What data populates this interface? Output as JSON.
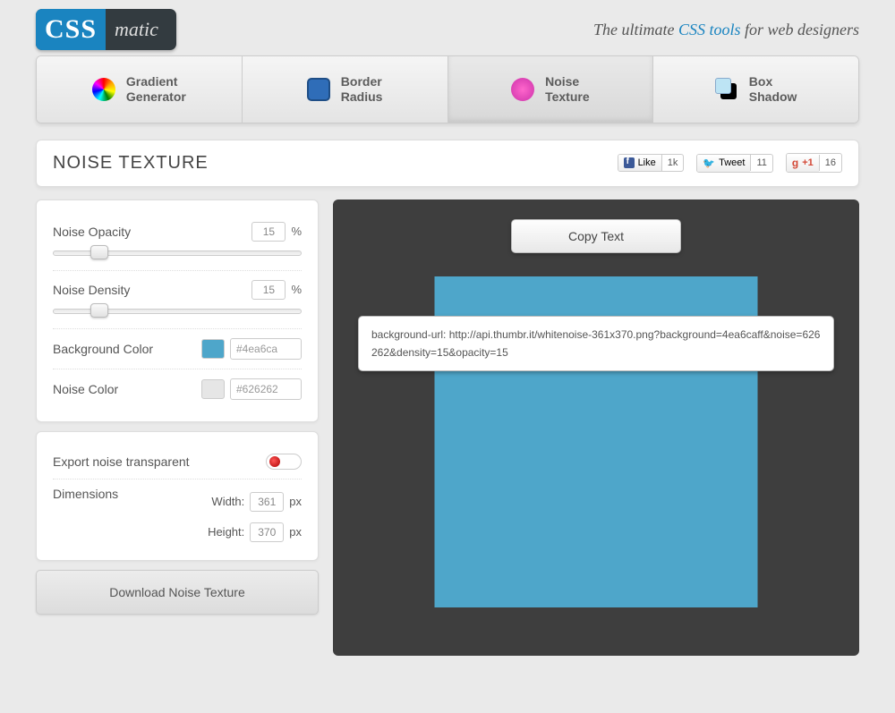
{
  "brand": {
    "left": "CSS",
    "right": "matic"
  },
  "tagline": {
    "pre": "The ultimate ",
    "accent": "CSS tools",
    "post": " for web designers"
  },
  "tabs": [
    {
      "label": "Gradient\nGenerator"
    },
    {
      "label": "Border\nRadius"
    },
    {
      "label": "Noise\nTexture"
    },
    {
      "label": "Box\nShadow"
    }
  ],
  "page_title": "NOISE TEXTURE",
  "social": {
    "fb": {
      "label": "Like",
      "count": "1k"
    },
    "tw": {
      "label": "Tweet",
      "count": "11"
    },
    "gp": {
      "label": "+1",
      "count": "16"
    }
  },
  "controls": {
    "opacity": {
      "label": "Noise Opacity",
      "value": "15",
      "unit": "%"
    },
    "density": {
      "label": "Noise Density",
      "value": "15",
      "unit": "%"
    },
    "bg": {
      "label": "Background Color",
      "hex": "#4ea6ca"
    },
    "noise": {
      "label": "Noise Color",
      "hex": "#626262"
    },
    "export": {
      "label": "Export noise transparent"
    },
    "dims": {
      "label": "Dimensions",
      "width_label": "Width:",
      "width": "361",
      "height_label": "Height:",
      "height": "370",
      "px": "px"
    }
  },
  "download_label": "Download Noise Texture",
  "preview": {
    "copy_label": "Copy Text",
    "code": "background-url: http://api.thumbr.it/whitenoise-361x370.png?background=4ea6caff&noise=626262&density=15&opacity=15"
  },
  "colors": {
    "bg_swatch": "#4ea6ca",
    "noise_swatch": "#e6e6e6"
  }
}
